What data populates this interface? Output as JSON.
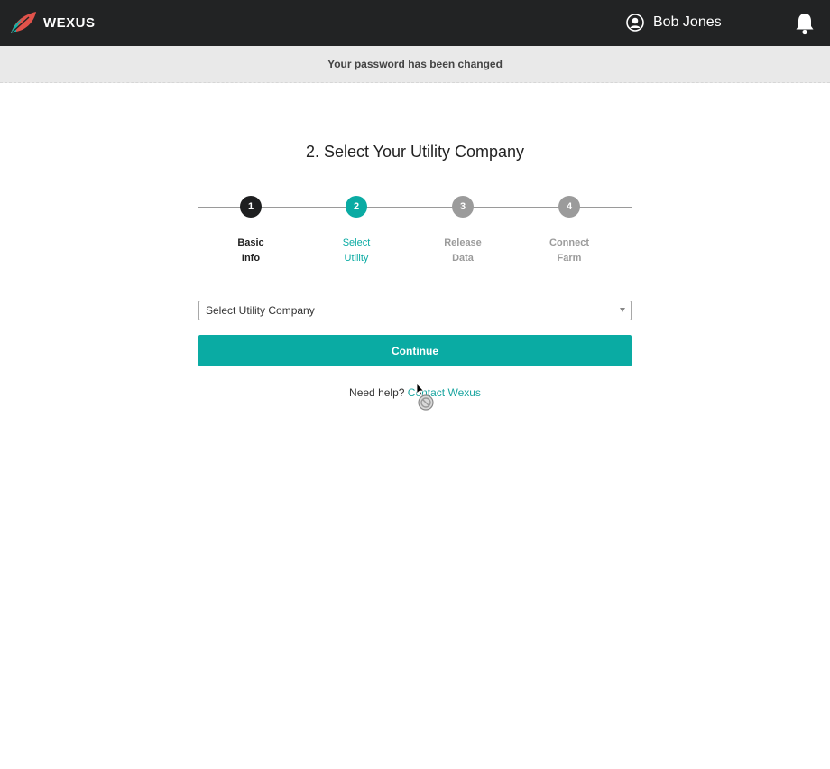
{
  "header": {
    "brand": "WEXUS",
    "user_name": "Bob Jones"
  },
  "notice": {
    "message": "Your password has been changed"
  },
  "main": {
    "title": "2. Select Your Utility Company",
    "steps": [
      {
        "number": "1",
        "line1": "Basic",
        "line2": "Info",
        "state": "done"
      },
      {
        "number": "2",
        "line1": "Select",
        "line2": "Utility",
        "state": "active"
      },
      {
        "number": "3",
        "line1": "Release",
        "line2": "Data",
        "state": "todo"
      },
      {
        "number": "4",
        "line1": "Connect",
        "line2": "Farm",
        "state": "todo"
      }
    ],
    "utility_select": {
      "value": "Select Utility Company"
    },
    "continue_label": "Continue",
    "help": {
      "prefix": "Need help?",
      "link": "Contact Wexus"
    }
  },
  "colors": {
    "topbar": "#222324",
    "accent": "#0aaba3",
    "done_step": "#1e1f20",
    "todo_step": "#9b9b9b"
  },
  "icons": {
    "logo": "wexus-logo-icon",
    "user": "user-icon",
    "notifications": "bell-icon"
  }
}
